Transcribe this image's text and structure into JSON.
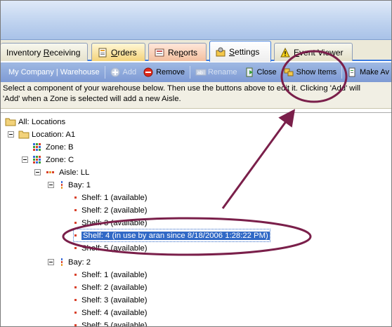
{
  "tabs": [
    {
      "label_pre": "Inventory ",
      "label_u": "R",
      "label_post": "eceiving"
    },
    {
      "label_pre": "",
      "label_u": "O",
      "label_post": "rders"
    },
    {
      "label_pre": "Re",
      "label_u": "p",
      "label_post": "orts"
    },
    {
      "label_pre": "",
      "label_u": "S",
      "label_post": "ettings"
    },
    {
      "label_pre": "",
      "label_u": "E",
      "label_post": "vent Viewer"
    }
  ],
  "toolbar": {
    "breadcrumb": "My Company | Warehouse",
    "add": "Add",
    "remove": "Remove",
    "rename": "Rename",
    "close": "Close",
    "show_items": "Show Items",
    "make_av": "Make Av"
  },
  "info": {
    "line1": "Select a component of your warehouse below. Then use the buttons above to edit it. Clicking 'Add' will",
    "line2": "'Add' when a Zone is selected will add a new Aisle."
  },
  "tree": [
    {
      "label": "All: Locations"
    },
    {
      "label": "Location: A1"
    },
    {
      "label": "Zone: B"
    },
    {
      "label": "Zone: C"
    },
    {
      "label": "Aisle: LL"
    },
    {
      "label": "Bay: 1"
    },
    {
      "label": "Shelf: 1 (available)"
    },
    {
      "label": "Shelf: 2 (available)"
    },
    {
      "label": "Shelf: 3 (available)"
    },
    {
      "label": "Shelf: 4 (in use by aran since 8/18/2006 1:28:22 PM)"
    },
    {
      "label": "Shelf: 5 (available)"
    },
    {
      "label": "Bay: 2"
    },
    {
      "label": "Shelf: 1 (available)"
    },
    {
      "label": "Shelf: 2 (available)"
    },
    {
      "label": "Shelf: 3 (available)"
    },
    {
      "label": "Shelf: 4 (available)"
    },
    {
      "label": "Shelf: 5 (available)"
    }
  ],
  "colors": {
    "annotation": "#7a1f4a",
    "selection": "#3169c6",
    "toolbar": "#8fa9dc"
  }
}
